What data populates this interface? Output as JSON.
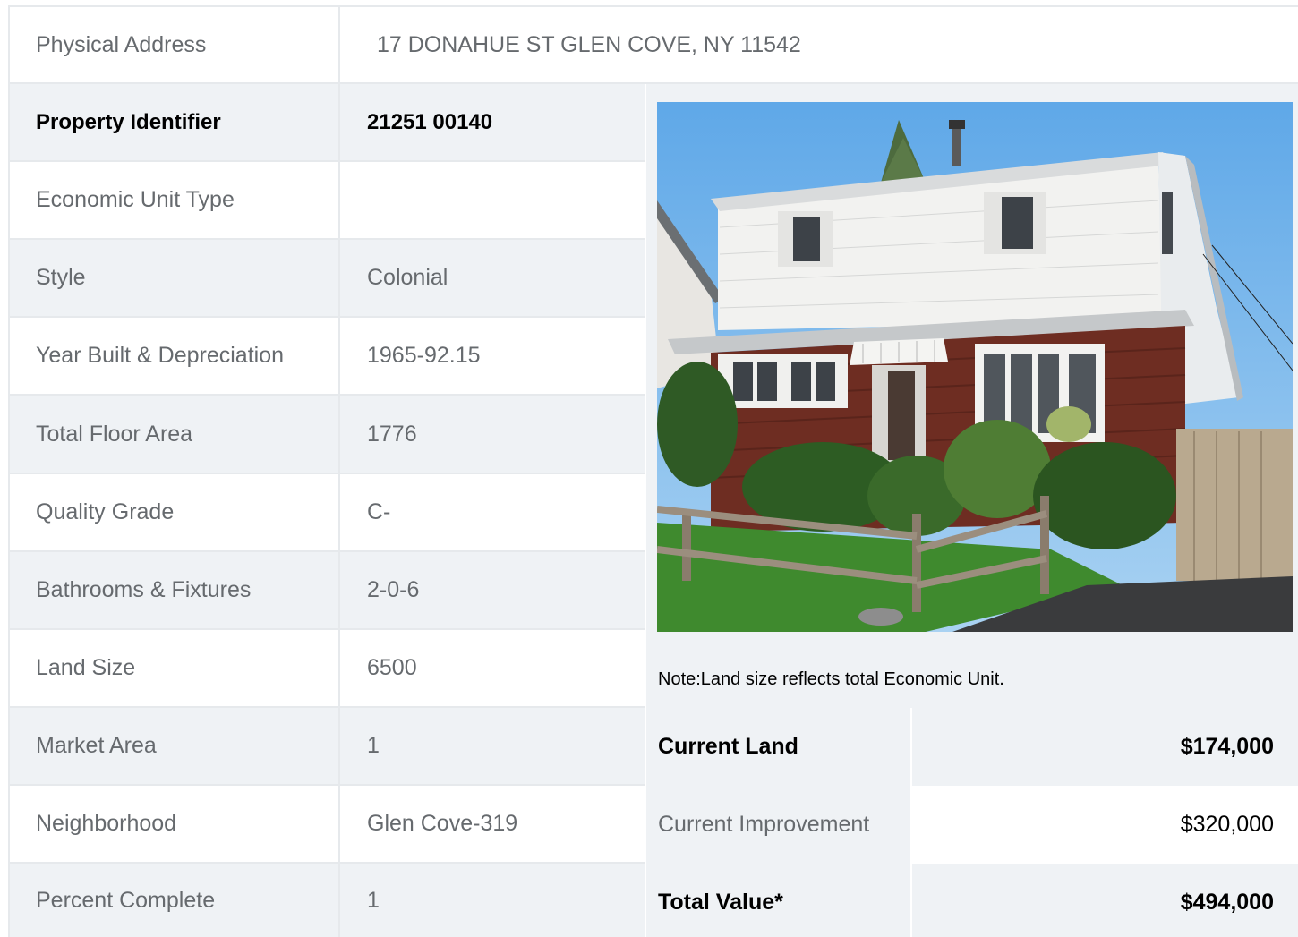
{
  "address": {
    "label": "Physical Address",
    "value": "17  DONAHUE ST  GLEN COVE, NY  11542"
  },
  "rows": [
    {
      "label": "Property Identifier",
      "value": "21251  00140"
    },
    {
      "label": "Economic Unit Type",
      "value": ""
    },
    {
      "label": "Style",
      "value": "Colonial"
    },
    {
      "label": "Year Built & Depreciation",
      "value": "1965-92.15"
    },
    {
      "label": "Total Floor Area",
      "value": "1776"
    },
    {
      "label": "Quality Grade",
      "value": "C-"
    },
    {
      "label": "Bathrooms & Fixtures",
      "value": "2-0-6"
    },
    {
      "label": "Land Size",
      "value": "6500"
    },
    {
      "label": "Market Area",
      "value": "1"
    },
    {
      "label": "Neighborhood",
      "value": "Glen Cove-319"
    },
    {
      "label": "Percent Complete",
      "value": "1"
    }
  ],
  "note": "Note:Land size reflects total Economic Unit.",
  "values": [
    {
      "label": "Current Land",
      "amount": "$174,000"
    },
    {
      "label": "Current Improvement",
      "amount": "$320,000"
    },
    {
      "label": "Total Value*",
      "amount": "$494,000"
    }
  ],
  "colors": {
    "text": "#666a6e",
    "alt_row": "#eff2f5",
    "border": "#e6e9ec",
    "emphasis": "#000000"
  }
}
